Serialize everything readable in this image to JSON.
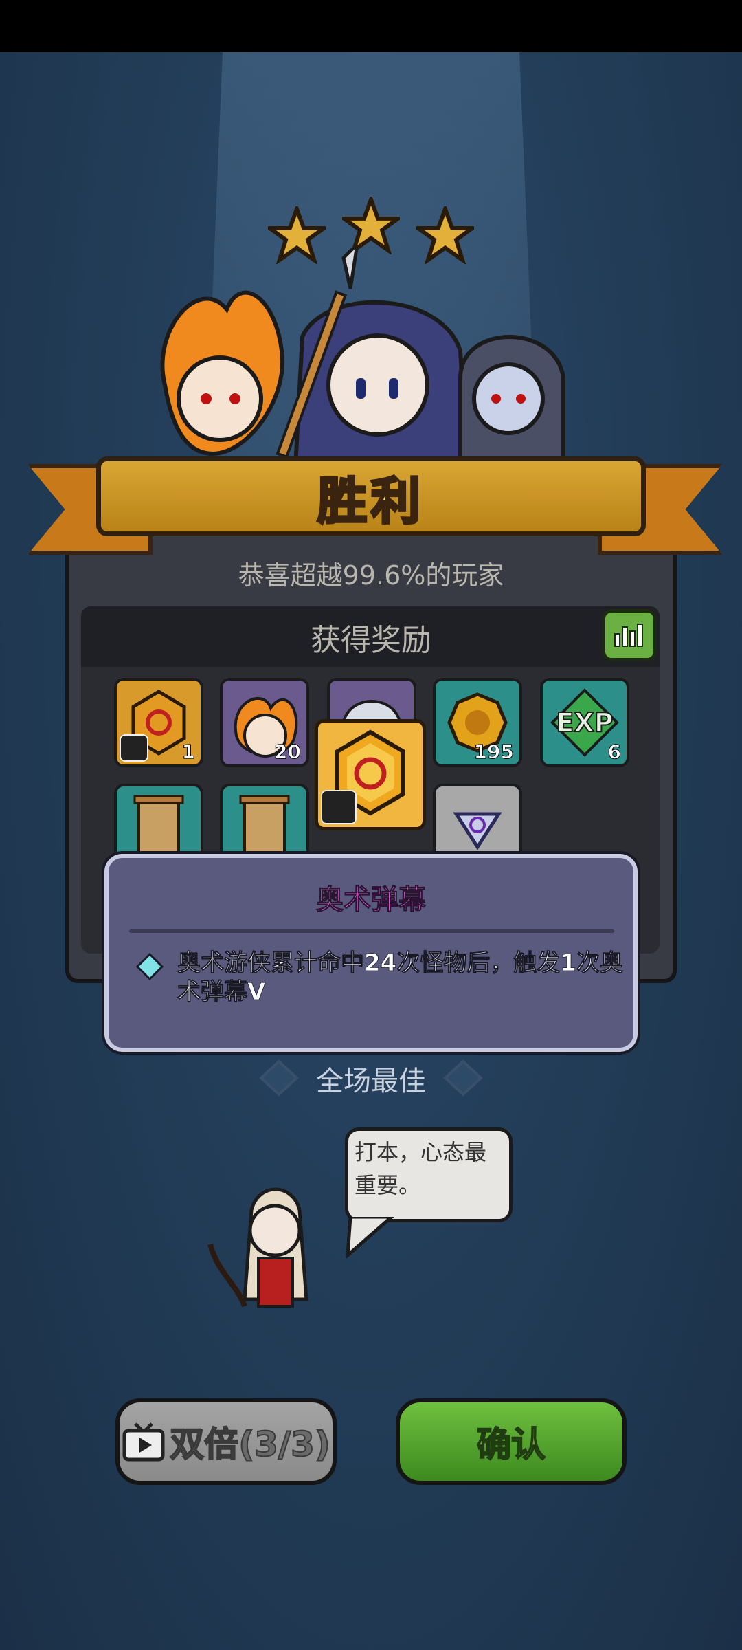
{
  "result": {
    "title": "胜利",
    "stars": 3,
    "congrats": "恭喜超越99.6%的玩家"
  },
  "rewards": {
    "title": "获得奖励",
    "items": [
      {
        "icon": "fire-gem-icon",
        "count": "1"
      },
      {
        "icon": "fire-hero-portrait-icon",
        "count": "20"
      },
      {
        "icon": "white-hair-hero-portrait-icon",
        "count": ""
      },
      {
        "icon": "gold-coin-icon",
        "count": "195"
      },
      {
        "icon": "exp-icon",
        "count": "6"
      },
      {
        "icon": "scroll-icon",
        "count": ""
      },
      {
        "icon": "scroll-icon",
        "count": ""
      },
      {
        "icon": "triangle-gem-icon",
        "count": ""
      }
    ]
  },
  "tooltip": {
    "title": "奥术弹幕",
    "text": "奥术游侠累计命中24次怪物后，触发1次奥术弹幕V"
  },
  "mvp": {
    "label": "全场最佳",
    "speech": "打本，心态最重要。"
  },
  "buttons": {
    "double": "双倍(3/3)",
    "confirm": "确认"
  },
  "colors": {
    "ribbon": "#c8901f",
    "confirm": "#5aa632",
    "tooltip_title": "#f062f0"
  }
}
